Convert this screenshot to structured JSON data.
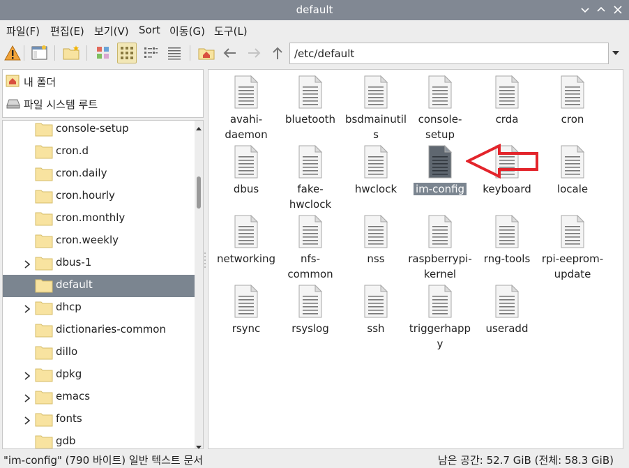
{
  "window": {
    "title": "default"
  },
  "menu": [
    "파일(F)",
    "편집(E)",
    "보기(V)",
    "Sort",
    "이동(G)",
    "도구(L)"
  ],
  "toolbar": {
    "path": "/etc/default"
  },
  "places": [
    {
      "label": "내 폴더",
      "icon": "home-icon"
    },
    {
      "label": "파일 시스템 루트",
      "icon": "drive-icon"
    }
  ],
  "tree": [
    {
      "label": "console-setup",
      "expandable": false,
      "selected": false
    },
    {
      "label": "cron.d",
      "expandable": false,
      "selected": false
    },
    {
      "label": "cron.daily",
      "expandable": false,
      "selected": false
    },
    {
      "label": "cron.hourly",
      "expandable": false,
      "selected": false
    },
    {
      "label": "cron.monthly",
      "expandable": false,
      "selected": false
    },
    {
      "label": "cron.weekly",
      "expandable": false,
      "selected": false
    },
    {
      "label": "dbus-1",
      "expandable": true,
      "selected": false
    },
    {
      "label": "default",
      "expandable": false,
      "selected": true
    },
    {
      "label": "dhcp",
      "expandable": true,
      "selected": false
    },
    {
      "label": "dictionaries-common",
      "expandable": false,
      "selected": false
    },
    {
      "label": "dillo",
      "expandable": false,
      "selected": false
    },
    {
      "label": "dpkg",
      "expandable": true,
      "selected": false
    },
    {
      "label": "emacs",
      "expandable": true,
      "selected": false
    },
    {
      "label": "fonts",
      "expandable": true,
      "selected": false
    },
    {
      "label": "gdb",
      "expandable": false,
      "selected": false
    }
  ],
  "files": [
    [
      "avahi-",
      "daemon"
    ],
    [
      "bluetooth"
    ],
    [
      "bsdmainutil",
      "s"
    ],
    [
      "console-",
      "setup"
    ],
    [
      "crda"
    ],
    [
      "cron"
    ],
    [
      "dbus"
    ],
    [
      "fake-",
      "hwclock"
    ],
    [
      "hwclock"
    ],
    [
      "im-config"
    ],
    [
      "keyboard"
    ],
    [
      "locale"
    ],
    [
      "networking"
    ],
    [
      "nfs-",
      "common"
    ],
    [
      "nss"
    ],
    [
      "raspberrypi-",
      "kernel"
    ],
    [
      "rng-tools"
    ],
    [
      "rpi-eeprom-",
      "update"
    ],
    [
      "rsync"
    ],
    [
      "rsyslog"
    ],
    [
      "ssh"
    ],
    [
      "triggerhapp",
      "y"
    ],
    [
      "useradd"
    ]
  ],
  "selected_file": "im-config",
  "status": {
    "left": "\"im-config\" (790 바이트) 일반 텍스트 문서",
    "right": "남은 공간: 52.7 GiB (전체: 58.3 GiB)"
  },
  "colors": {
    "titlebar": "#818893",
    "selection": "#7b8590",
    "folder": "#f8e3a0",
    "arrow": "#e3242b"
  }
}
